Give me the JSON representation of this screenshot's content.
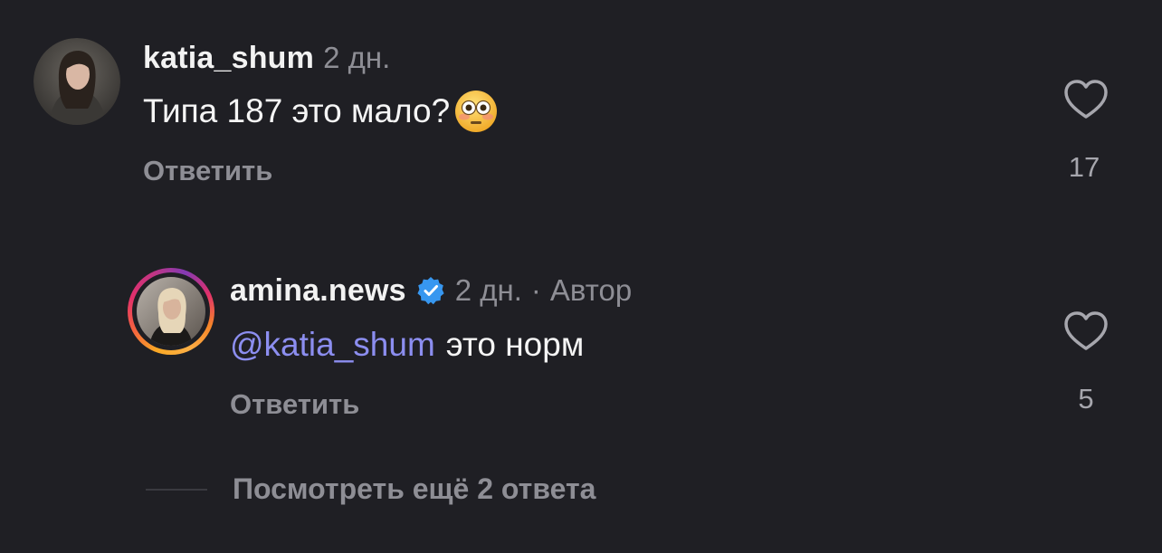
{
  "comments": [
    {
      "username": "katia_shum",
      "time": "2 дн.",
      "text": "Типа 187 это мало?",
      "emoji_icon": "flushed-face-icon",
      "reply_label": "Ответить",
      "likes": "17",
      "avatar_icon": "user-avatar"
    },
    {
      "username": "amina.news",
      "verified": true,
      "time": "2 дн.",
      "separator": "·",
      "author_tag": "Автор",
      "mention": "@katia_shum",
      "text": "это норм",
      "reply_label": "Ответить",
      "likes": "5",
      "avatar_icon": "user-avatar-story-ring"
    }
  ],
  "view_more_label": "Посмотреть ещё 2 ответа",
  "colors": {
    "background": "#1f1f24",
    "username": "#f2f2f2",
    "muted": "#8e8e95",
    "mention": "#8c8ef0",
    "verified": "#3797f0"
  }
}
